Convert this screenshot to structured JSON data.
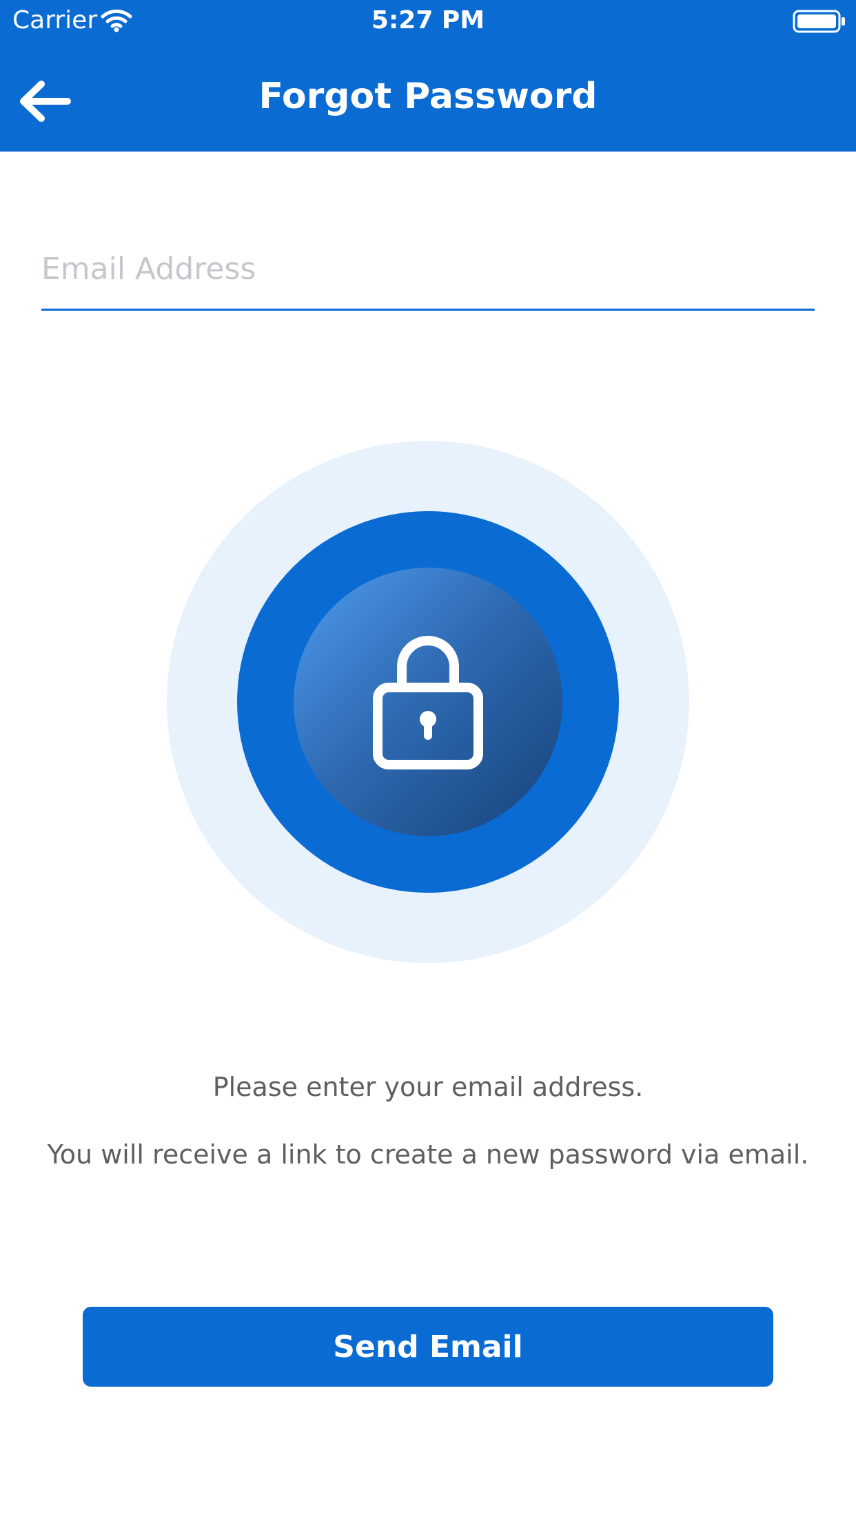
{
  "status_bar": {
    "carrier": "Carrier",
    "time": "5:27 PM",
    "wifi_icon": "wifi-icon",
    "battery_icon": "battery-full-icon"
  },
  "nav_bar": {
    "title": "Forgot Password",
    "back_icon": "arrow-left-icon"
  },
  "form": {
    "email_placeholder": "Email Address",
    "email_value": ""
  },
  "illustration": {
    "icon": "lock-icon",
    "colors": {
      "outer_ring": "#e8f2fc",
      "middle_ring": "#0a6bd3",
      "inner_gradient_start": "#4f9cf0",
      "inner_gradient_end": "#17427a"
    }
  },
  "instructions": {
    "line1": "Please enter your email address.",
    "line2": "You will receive a link to create a new password via email."
  },
  "actions": {
    "send_label": "Send Email"
  },
  "theme": {
    "primary": "#0a6bd3",
    "text_secondary": "#5f5f5f",
    "placeholder": "#c4c7cc",
    "background": "#ffffff"
  }
}
